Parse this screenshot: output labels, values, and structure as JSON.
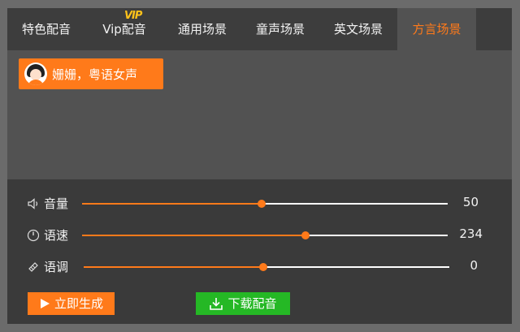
{
  "tabs": [
    {
      "label": "特色配音",
      "active": false
    },
    {
      "label": "Vip配音",
      "badge": "VIP",
      "active": false
    },
    {
      "label": "通用场景",
      "active": false
    },
    {
      "label": "童声场景",
      "active": false
    },
    {
      "label": "英文场景",
      "active": false
    },
    {
      "label": "方言场景",
      "active": true
    }
  ],
  "voice": {
    "label": "姗姗，粤语女声"
  },
  "controls": {
    "volume": {
      "label": "音量",
      "value": "50",
      "level": 0.49,
      "icon": "speaker-icon"
    },
    "speed": {
      "label": "语速",
      "value": "234",
      "level": 0.61,
      "icon": "speedometer-icon"
    },
    "tone": {
      "label": "语调",
      "value": "0",
      "level": 0.49,
      "icon": "tone-icon"
    }
  },
  "buttons": {
    "generate": "立即生成",
    "download": "下载配音"
  },
  "colors": {
    "accent": "#ff7a1a",
    "download": "#25b825",
    "vip_badge": "#ffc21a"
  }
}
